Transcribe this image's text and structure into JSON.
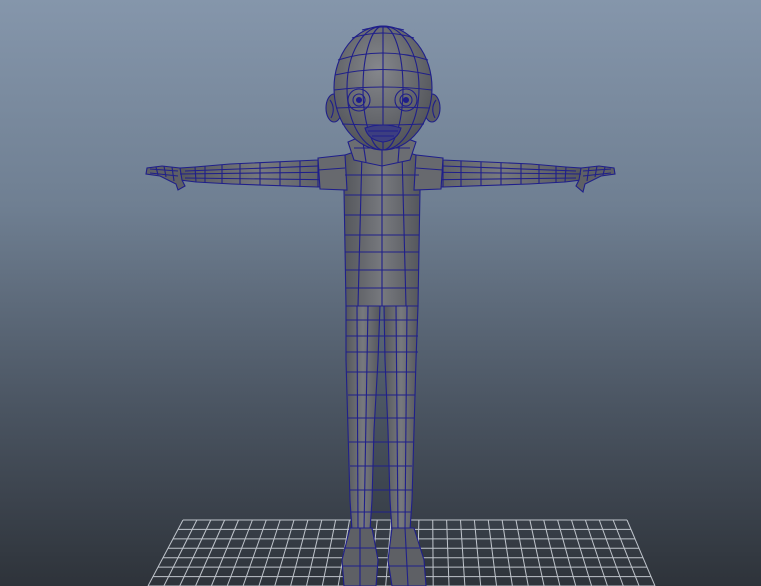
{
  "viewport": {
    "panel": "perspective-viewport",
    "display_mode": "wireframe-on-shaded",
    "background_gradient": [
      "#8596ab",
      "#6f7f92",
      "#4a5461",
      "#2e333a"
    ]
  },
  "scene": {
    "model": "character-mesh",
    "pose": "t-pose",
    "mesh_fill": "#6e7075",
    "mesh_fill_dark": "#56585d",
    "wire_color": "#1f1f8a",
    "grid_color": "#d8dde4"
  }
}
